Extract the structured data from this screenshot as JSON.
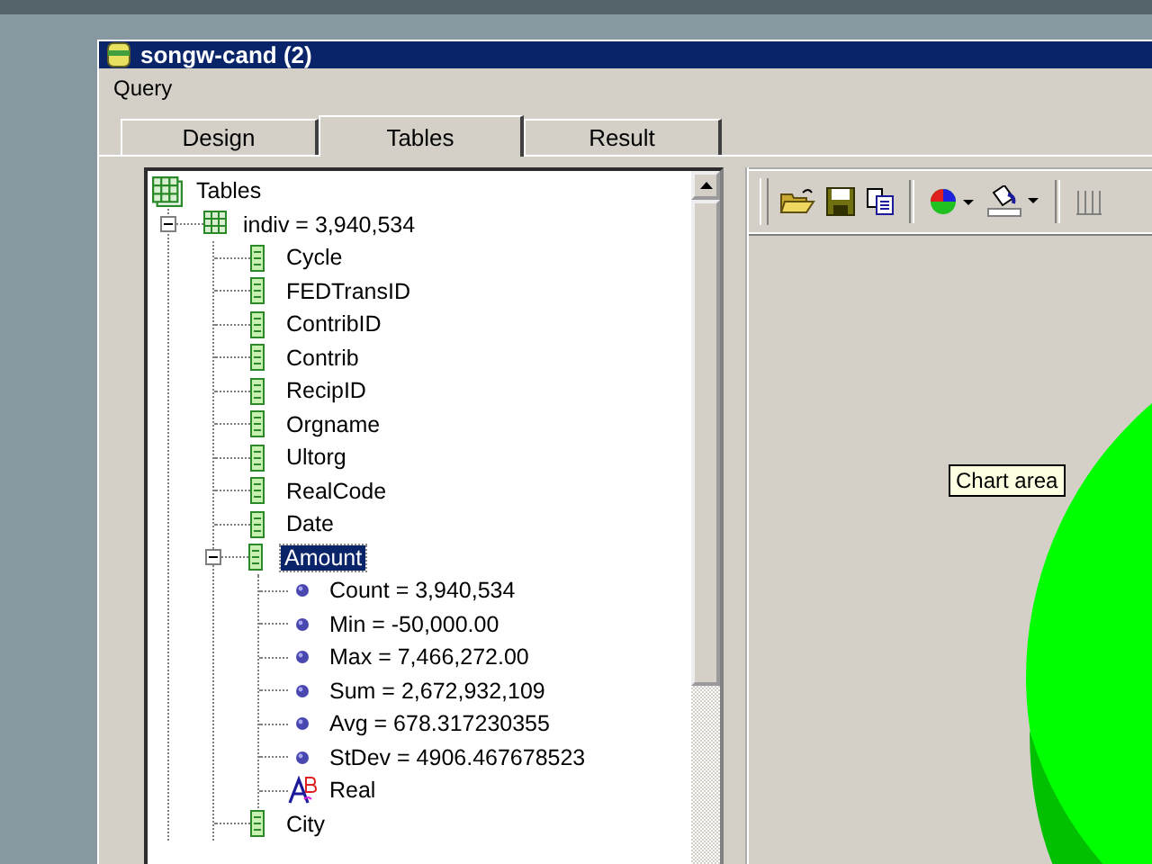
{
  "window": {
    "title": "songw-cand (2)"
  },
  "menu": [
    "Query"
  ],
  "tabs": [
    {
      "label": "Design",
      "selected": false
    },
    {
      "label": "Tables",
      "selected": true
    },
    {
      "label": "Result",
      "selected": false
    }
  ],
  "tree": {
    "label": "Tables",
    "kind": "root",
    "selected": false,
    "children": [
      {
        "label": "indiv = 3,940,534",
        "kind": "table",
        "expanded": true,
        "selected": false,
        "children": [
          {
            "label": "Cycle",
            "kind": "field",
            "selected": false
          },
          {
            "label": "FEDTransID",
            "kind": "field",
            "selected": false
          },
          {
            "label": "ContribID",
            "kind": "field",
            "selected": false
          },
          {
            "label": "Contrib",
            "kind": "field",
            "selected": false
          },
          {
            "label": "RecipID",
            "kind": "field",
            "selected": false
          },
          {
            "label": "Orgname",
            "kind": "field",
            "selected": false
          },
          {
            "label": "Ultorg",
            "kind": "field",
            "selected": false
          },
          {
            "label": "RealCode",
            "kind": "field",
            "selected": false
          },
          {
            "label": "Date",
            "kind": "field",
            "selected": false
          },
          {
            "label": "Amount",
            "kind": "field",
            "expanded": true,
            "selected": true,
            "children": [
              {
                "label": "Count = 3,940,534",
                "kind": "stat",
                "selected": false
              },
              {
                "label": "Min = -50,000.00",
                "kind": "stat",
                "selected": false
              },
              {
                "label": "Max = 7,466,272.00",
                "kind": "stat",
                "selected": false
              },
              {
                "label": "Sum = 2,672,932,109",
                "kind": "stat",
                "selected": false
              },
              {
                "label": "Avg = 678.317230355",
                "kind": "stat",
                "selected": false
              },
              {
                "label": "StDev = 4906.467678523",
                "kind": "stat",
                "selected": false
              },
              {
                "label": "Real",
                "kind": "type",
                "selected": false
              }
            ]
          },
          {
            "label": "City",
            "kind": "field",
            "selected": false
          }
        ]
      }
    ]
  },
  "chart": {
    "tooltip": "Chart area"
  }
}
